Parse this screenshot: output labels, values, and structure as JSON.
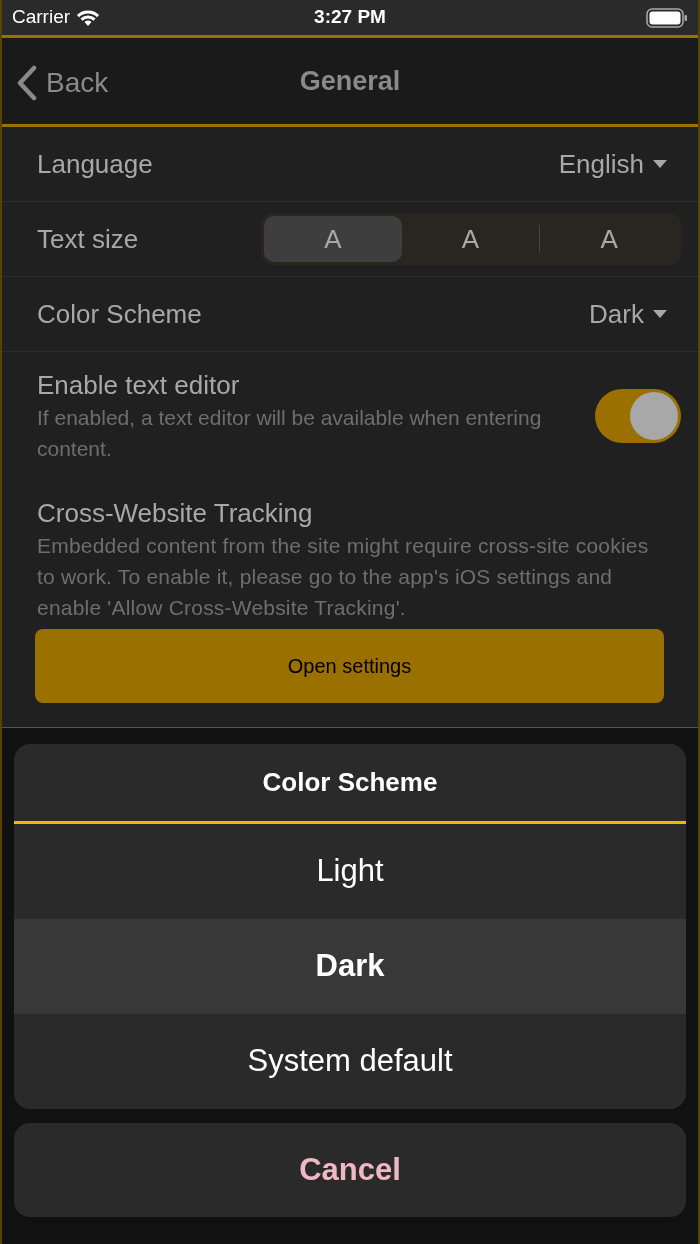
{
  "status_bar": {
    "carrier": "Carrier",
    "time": "3:27 PM"
  },
  "nav": {
    "back": "Back",
    "title": "General"
  },
  "settings": [
    {
      "kind": "dropdown",
      "label": "Language",
      "value": "English"
    },
    {
      "kind": "segments",
      "label": "Text size",
      "segments": [
        {
          "label": "A",
          "selected": true
        },
        {
          "label": "A",
          "selected": false
        },
        {
          "label": "A",
          "selected": false
        }
      ]
    },
    {
      "kind": "dropdown",
      "label": "Color Scheme",
      "value": "Dark"
    },
    {
      "kind": "toggle",
      "label": "Enable text editor",
      "description": "If enabled, a text editor will be available when entering content.",
      "on": true
    },
    {
      "kind": "action",
      "label": "Cross-Website Tracking",
      "description": "Embedded content from the site might require cross-site cookies to work. To enable it, please go to the app's iOS settings and enable 'Allow Cross-Website Tracking'.",
      "button": "Open settings"
    }
  ],
  "action_sheet": {
    "title": "Color Scheme",
    "options": [
      {
        "label": "Light",
        "selected": false
      },
      {
        "label": "Dark",
        "selected": true
      },
      {
        "label": "System default",
        "selected": false
      }
    ],
    "cancel": "Cancel"
  }
}
